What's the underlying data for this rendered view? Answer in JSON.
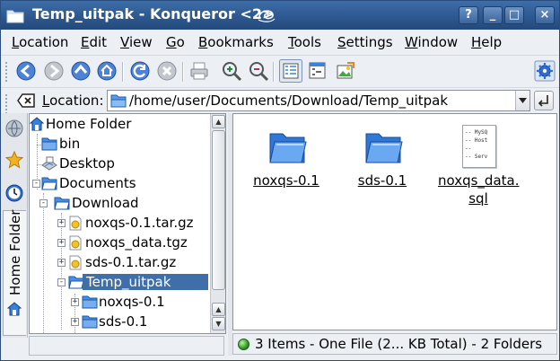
{
  "window": {
    "title": "Temp_uitpak - Konqueror <2>",
    "buttons": [
      "?",
      "_",
      "□",
      "×"
    ]
  },
  "menubar": {
    "items": [
      {
        "first": "L",
        "rest": "ocation"
      },
      {
        "first": "E",
        "rest": "dit"
      },
      {
        "first": "V",
        "rest": "iew"
      },
      {
        "first": "G",
        "rest": "o"
      },
      {
        "first": "B",
        "rest": "ookmarks"
      },
      {
        "first": "T",
        "rest": "ools"
      },
      {
        "first": "S",
        "rest": "ettings"
      },
      {
        "first": "W",
        "rest": "indow"
      },
      {
        "first": "H",
        "rest": "elp"
      }
    ]
  },
  "toolbar": {
    "icons": [
      "back-icon",
      "forward-icon",
      "up-icon",
      "home-icon",
      "reload-icon",
      "stop-icon",
      "print-icon",
      "zoom-in-icon",
      "zoom-out-icon",
      "icon-view-icon",
      "tree-view-icon",
      "preview-icon",
      "konqueror-gear-icon"
    ]
  },
  "location": {
    "label_first": "L",
    "label_rest": "ocation:",
    "value": "/home/user/Documents/Download/Temp_uitpak"
  },
  "sidebar": {
    "tab_label": "Home Folder"
  },
  "tree": {
    "items": [
      {
        "label": "Home Folder",
        "icon": "home-folder-icon"
      },
      {
        "label": "bin",
        "icon": "folder-icon"
      },
      {
        "label": "Desktop",
        "icon": "desktop-icon"
      },
      {
        "label": "Documents",
        "icon": "folder-open-icon"
      },
      {
        "label": "Download",
        "icon": "folder-open-icon"
      },
      {
        "label": "noxqs-0.1.tar.gz",
        "icon": "archive-icon"
      },
      {
        "label": "noxqs_data.tgz",
        "icon": "archive-icon"
      },
      {
        "label": "sds-0.1.tar.gz",
        "icon": "archive-icon"
      },
      {
        "label": "Temp_uitpak",
        "icon": "folder-open-icon"
      },
      {
        "label": "noxqs-0.1",
        "icon": "folder-icon"
      },
      {
        "label": "sds-0.1",
        "icon": "folder-icon"
      }
    ]
  },
  "files": {
    "items": [
      {
        "name_line1": "noxqs-0.1",
        "name_line2": "",
        "icon": "folder-icon"
      },
      {
        "name_line1": "sds-0.1",
        "name_line2": "",
        "icon": "folder-icon"
      },
      {
        "name_line1": "noxqs_data.",
        "name_line2": "sql",
        "icon": "sql-file-icon"
      }
    ],
    "sql_preview": [
      "-- MySQ",
      "-- Host",
      "--",
      "-- Serv"
    ]
  },
  "status": {
    "text": "3 Items - One File (2... KB Total) - 2 Folders"
  },
  "colors": {
    "titlebar": "#2d5890",
    "selection": "#3f6ea8",
    "folder": "#3a82e0"
  }
}
